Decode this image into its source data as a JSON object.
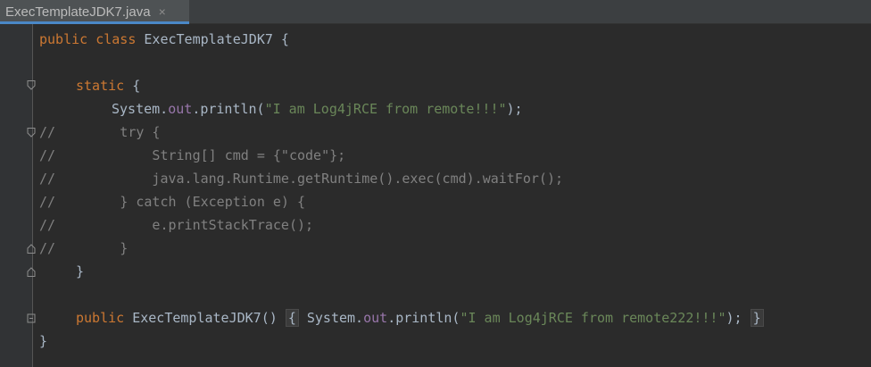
{
  "tab": {
    "filename": "ExecTemplateJDK7.java",
    "close_glyph": "×"
  },
  "code": {
    "l1": {
      "kw1": "public",
      "kw2": "class",
      "name": "ExecTemplateJDK7 {"
    },
    "l3": {
      "kw": "static",
      "rest": " {"
    },
    "l4": {
      "prefix": "System.",
      "field": "out",
      "mid": ".println(",
      "str": "\"I am Log4jRCE from remote!!!\"",
      "end": ");"
    },
    "l5": "//        try {",
    "l6": "//            String[] cmd = {\"code\"};",
    "l7": "//            java.lang.Runtime.getRuntime().exec(cmd).waitFor();",
    "l8": "//        } catch (Exception e) {",
    "l9": "//            e.printStackTrace();",
    "l10": "//        }",
    "l11": "}",
    "l13": {
      "kw": "public",
      "sig": " ExecTemplateJDK7() ",
      "open": "{",
      "prefix": " System.",
      "field": "out",
      "mid": ".println(",
      "str": "\"I am Log4jRCE from remote222!!!\"",
      "end": ");",
      "close": "}"
    },
    "l14": "}"
  },
  "colors": {
    "background": "#2b2b2b",
    "keyword": "#cc7832",
    "string": "#6a8759",
    "comment": "#808080",
    "field": "#9876aa",
    "plain": "#a9b7c6"
  }
}
